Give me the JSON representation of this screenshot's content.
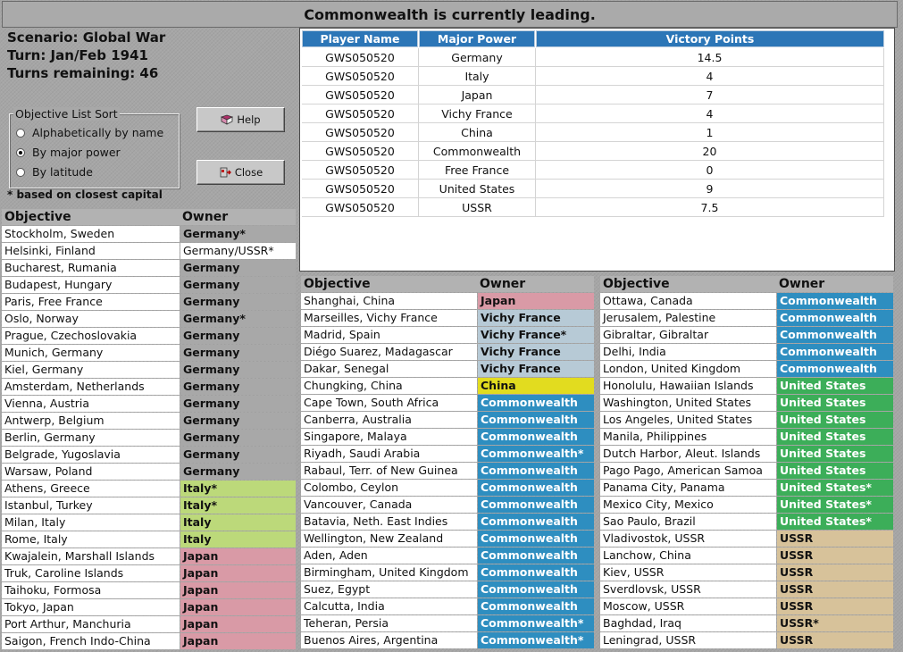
{
  "banner": "Commonwealth is currently leading.",
  "scenario": {
    "line1": "Scenario: Global War",
    "line2": "Turn: Jan/Feb 1941",
    "line3": "Turns remaining: 46"
  },
  "sort": {
    "legend": "Objective List Sort",
    "options": [
      "Alphabetically by name",
      "By major power",
      "By latitude"
    ],
    "selected": "By major power"
  },
  "buttons": {
    "help": "Help",
    "close": "Close"
  },
  "note": "* based on closest capital",
  "vp": {
    "headers": [
      "Player Name",
      "Major Power",
      "Victory Points"
    ],
    "rows": [
      {
        "player": "GWS050520",
        "power": "Germany",
        "points": "14.5"
      },
      {
        "player": "GWS050520",
        "power": "Italy",
        "points": "4"
      },
      {
        "player": "GWS050520",
        "power": "Japan",
        "points": "7"
      },
      {
        "player": "GWS050520",
        "power": "Vichy France",
        "points": "4"
      },
      {
        "player": "GWS050520",
        "power": "China",
        "points": "1"
      },
      {
        "player": "GWS050520",
        "power": "Commonwealth",
        "points": "20"
      },
      {
        "player": "GWS050520",
        "power": "Free France",
        "points": "0"
      },
      {
        "player": "GWS050520",
        "power": "United States",
        "points": "9"
      },
      {
        "player": "GWS050520",
        "power": "USSR",
        "points": "7.5"
      }
    ]
  },
  "owner_colors": {
    "Germany": "#a8a8a8",
    "Germany/USSR": "#ffffff",
    "Italy": "#bcd97a",
    "Japan": "#d99aa6",
    "Vichy France": "#b7cad6",
    "China": "#e2dc1f",
    "Commonwealth": "#2e8ec0",
    "United States": "#3cae59",
    "USSR": "#d7c29a"
  },
  "light_text_owners": [
    "Commonwealth",
    "United States"
  ],
  "objectives": {
    "headers": {
      "objective": "Objective",
      "owner": "Owner"
    },
    "col1": [
      {
        "name": "Stockholm, Sweden",
        "owner": "Germany",
        "star": true
      },
      {
        "name": "Helsinki, Finland",
        "owner": "Germany/USSR",
        "star": true
      },
      {
        "name": "Bucharest, Rumania",
        "owner": "Germany",
        "star": false
      },
      {
        "name": "Budapest, Hungary",
        "owner": "Germany",
        "star": false
      },
      {
        "name": "Paris, Free France",
        "owner": "Germany",
        "star": false
      },
      {
        "name": "Oslo, Norway",
        "owner": "Germany",
        "star": true
      },
      {
        "name": "Prague, Czechoslovakia",
        "owner": "Germany",
        "star": false
      },
      {
        "name": "Munich, Germany",
        "owner": "Germany",
        "star": false
      },
      {
        "name": "Kiel, Germany",
        "owner": "Germany",
        "star": false
      },
      {
        "name": "Amsterdam, Netherlands",
        "owner": "Germany",
        "star": false
      },
      {
        "name": "Vienna, Austria",
        "owner": "Germany",
        "star": false
      },
      {
        "name": "Antwerp, Belgium",
        "owner": "Germany",
        "star": false
      },
      {
        "name": "Berlin, Germany",
        "owner": "Germany",
        "star": false
      },
      {
        "name": "Belgrade, Yugoslavia",
        "owner": "Germany",
        "star": false
      },
      {
        "name": "Warsaw, Poland",
        "owner": "Germany",
        "star": false
      },
      {
        "name": "Athens, Greece",
        "owner": "Italy",
        "star": true
      },
      {
        "name": "Istanbul, Turkey",
        "owner": "Italy",
        "star": true
      },
      {
        "name": "Milan, Italy",
        "owner": "Italy",
        "star": false
      },
      {
        "name": "Rome, Italy",
        "owner": "Italy",
        "star": false
      },
      {
        "name": "Kwajalein, Marshall Islands",
        "owner": "Japan",
        "star": false
      },
      {
        "name": "Truk, Caroline Islands",
        "owner": "Japan",
        "star": false
      },
      {
        "name": "Taihoku, Formosa",
        "owner": "Japan",
        "star": false
      },
      {
        "name": "Tokyo, Japan",
        "owner": "Japan",
        "star": false
      },
      {
        "name": "Port Arthur, Manchuria",
        "owner": "Japan",
        "star": false
      },
      {
        "name": "Saigon, French Indo-China",
        "owner": "Japan",
        "star": false
      }
    ],
    "col2": [
      {
        "name": "Shanghai, China",
        "owner": "Japan",
        "star": false
      },
      {
        "name": "Marseilles, Vichy France",
        "owner": "Vichy France",
        "star": false
      },
      {
        "name": "Madrid, Spain",
        "owner": "Vichy France",
        "star": true
      },
      {
        "name": "Diégo Suarez, Madagascar",
        "owner": "Vichy France",
        "star": false
      },
      {
        "name": "Dakar, Senegal",
        "owner": "Vichy France",
        "star": false
      },
      {
        "name": "Chungking, China",
        "owner": "China",
        "star": false
      },
      {
        "name": "Cape Town, South Africa",
        "owner": "Commonwealth",
        "star": false
      },
      {
        "name": "Canberra, Australia",
        "owner": "Commonwealth",
        "star": false
      },
      {
        "name": "Singapore, Malaya",
        "owner": "Commonwealth",
        "star": false
      },
      {
        "name": "Riyadh, Saudi Arabia",
        "owner": "Commonwealth",
        "star": true
      },
      {
        "name": "Rabaul, Terr. of New Guinea",
        "owner": "Commonwealth",
        "star": false
      },
      {
        "name": "Colombo, Ceylon",
        "owner": "Commonwealth",
        "star": false
      },
      {
        "name": "Vancouver, Canada",
        "owner": "Commonwealth",
        "star": false
      },
      {
        "name": "Batavia, Neth. East Indies",
        "owner": "Commonwealth",
        "star": false
      },
      {
        "name": "Wellington, New Zealand",
        "owner": "Commonwealth",
        "star": false
      },
      {
        "name": "Aden, Aden",
        "owner": "Commonwealth",
        "star": false
      },
      {
        "name": "Birmingham, United Kingdom",
        "owner": "Commonwealth",
        "star": false
      },
      {
        "name": "Suez, Egypt",
        "owner": "Commonwealth",
        "star": false
      },
      {
        "name": "Calcutta, India",
        "owner": "Commonwealth",
        "star": false
      },
      {
        "name": "Teheran, Persia",
        "owner": "Commonwealth",
        "star": true
      },
      {
        "name": "Buenos Aires, Argentina",
        "owner": "Commonwealth",
        "star": true
      }
    ],
    "col3": [
      {
        "name": "Ottawa, Canada",
        "owner": "Commonwealth",
        "star": false
      },
      {
        "name": "Jerusalem, Palestine",
        "owner": "Commonwealth",
        "star": false
      },
      {
        "name": "Gibraltar, Gibraltar",
        "owner": "Commonwealth",
        "star": false
      },
      {
        "name": "Delhi, India",
        "owner": "Commonwealth",
        "star": false
      },
      {
        "name": "London, United Kingdom",
        "owner": "Commonwealth",
        "star": false
      },
      {
        "name": "Honolulu, Hawaiian Islands",
        "owner": "United States",
        "star": false
      },
      {
        "name": "Washington, United States",
        "owner": "United States",
        "star": false
      },
      {
        "name": "Los Angeles, United States",
        "owner": "United States",
        "star": false
      },
      {
        "name": "Manila, Philippines",
        "owner": "United States",
        "star": false
      },
      {
        "name": "Dutch Harbor, Aleut. Islands",
        "owner": "United States",
        "star": false
      },
      {
        "name": "Pago Pago, American Samoa",
        "owner": "United States",
        "star": false
      },
      {
        "name": "Panama City, Panama",
        "owner": "United States",
        "star": true
      },
      {
        "name": "Mexico City, Mexico",
        "owner": "United States",
        "star": true
      },
      {
        "name": "Sao Paulo, Brazil",
        "owner": "United States",
        "star": true
      },
      {
        "name": "Vladivostok, USSR",
        "owner": "USSR",
        "star": false
      },
      {
        "name": "Lanchow, China",
        "owner": "USSR",
        "star": false
      },
      {
        "name": "Kiev, USSR",
        "owner": "USSR",
        "star": false
      },
      {
        "name": "Sverdlovsk, USSR",
        "owner": "USSR",
        "star": false
      },
      {
        "name": "Moscow, USSR",
        "owner": "USSR",
        "star": false
      },
      {
        "name": "Baghdad, Iraq",
        "owner": "USSR",
        "star": true
      },
      {
        "name": "Leningrad, USSR",
        "owner": "USSR",
        "star": false
      }
    ]
  }
}
